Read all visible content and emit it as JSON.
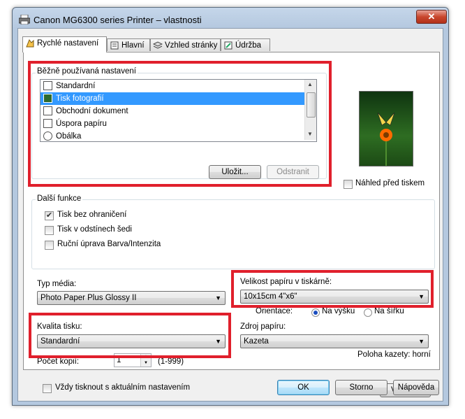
{
  "window": {
    "title": "Canon MG6300 series Printer – vlastnosti",
    "close_label": "✕"
  },
  "tabs": [
    {
      "label": "Rychlé nastavení",
      "active": true
    },
    {
      "label": "Hlavní",
      "active": false
    },
    {
      "label": "Vzhled stránky",
      "active": false
    },
    {
      "label": "Údržba",
      "active": false
    }
  ],
  "common_settings": {
    "group_label": "Běžně používaná nastavení",
    "items": [
      "Standardní",
      "Tisk fotografií",
      "Obchodní dokument",
      "Úspora papíru",
      "Obálka"
    ],
    "selected_index": 1,
    "save_button": "Uložit...",
    "delete_button": "Odstranit"
  },
  "preview": {
    "checkbox_label": "Náhled před tiskem",
    "checked": false
  },
  "additional": {
    "group_label": "Další funkce",
    "options": [
      {
        "label": "Tisk bez ohraničení",
        "checked": true
      },
      {
        "label": "Tisk v odstínech šedi",
        "checked": false
      },
      {
        "label": "Ruční úprava Barva/Intenzita",
        "checked": false
      }
    ]
  },
  "media_type": {
    "label": "Typ média:",
    "value": "Photo Paper Plus Glossy II"
  },
  "paper_size": {
    "label": "Velikost papíru v tiskárně:",
    "value": "10x15cm 4\"x6\""
  },
  "orientation": {
    "label": "Orientace:",
    "portrait": "Na výšku",
    "landscape": "Na šířku",
    "selected": "portrait"
  },
  "print_quality": {
    "label": "Kvalita tisku:",
    "value": "Standardní"
  },
  "paper_source": {
    "label": "Zdroj papíru:",
    "value": "Kazeta",
    "cassette_position": "Poloha kazety: horní"
  },
  "copies": {
    "label": "Počet kopií:",
    "value": "1",
    "range": "(1-999)"
  },
  "always_print": {
    "label": "Vždy tisknout s aktuálním nastavením",
    "checked": false
  },
  "defaults_button": "Výchozí",
  "dialog_buttons": {
    "ok": "OK",
    "cancel": "Storno",
    "help": "Nápověda"
  },
  "colors": {
    "highlight": "#e0202c",
    "selection": "#3399ff"
  }
}
